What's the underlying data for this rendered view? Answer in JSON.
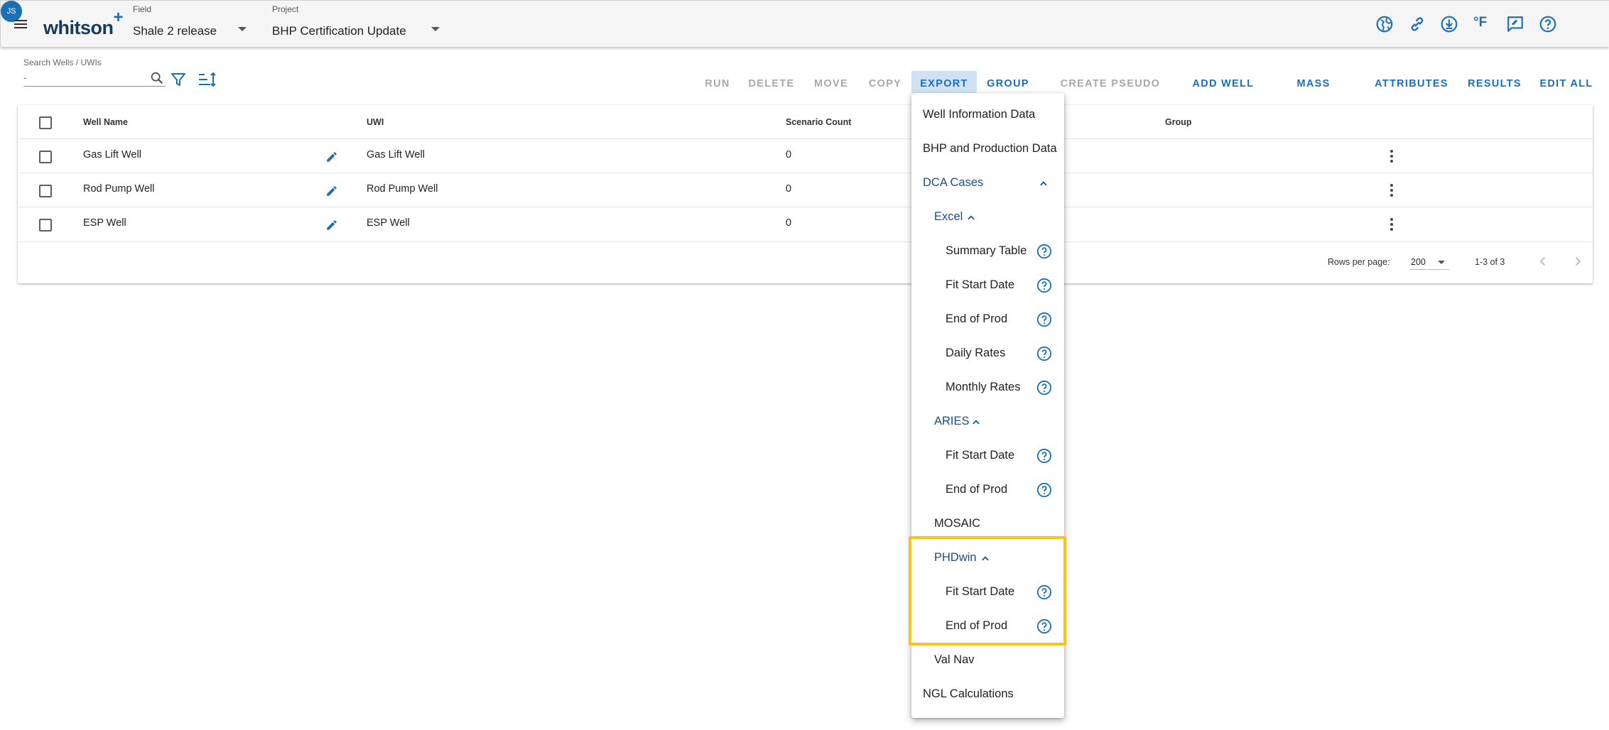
{
  "header": {
    "logo_text": "whitson",
    "logo_plus": "+",
    "field": {
      "label": "Field",
      "value": "Shale 2 release"
    },
    "project": {
      "label": "Project",
      "value": "BHP Certification Update"
    },
    "icons": [
      "globe-icon",
      "link-icon",
      "download-icon",
      "fahrenheit-icon",
      "feedback-icon",
      "help-icon"
    ],
    "fahrenheit_label": "°F",
    "avatar_initials": "JS"
  },
  "toolbar": {
    "search_label": "Search Wells / UWIs",
    "search_placeholder": "-",
    "buttons": {
      "run": "RUN",
      "delete": "DELETE",
      "move": "MOVE",
      "copy": "COPY",
      "export": "EXPORT",
      "group": "GROUP",
      "create_pseudo_well": "CREATE PSEUDO WELL",
      "add_well": "ADD WELL",
      "mass_upload": "MASS UPLOAD",
      "attributes": "ATTRIBUTES",
      "results": "RESULTS",
      "edit_all": "EDIT ALL"
    }
  },
  "table": {
    "columns": [
      "Well Name",
      "UWI",
      "Scenario Count",
      "Group"
    ],
    "rows": [
      {
        "well_name": "Gas Lift Well",
        "uwi": "Gas Lift Well",
        "scenario_count": "0",
        "group": ""
      },
      {
        "well_name": "Rod Pump Well",
        "uwi": "Rod Pump Well",
        "scenario_count": "0",
        "group": ""
      },
      {
        "well_name": "ESP Well",
        "uwi": "ESP Well",
        "scenario_count": "0",
        "group": ""
      }
    ],
    "footer": {
      "rows_per_page_label": "Rows per page:",
      "rows_per_page_value": "200",
      "range": "1-3 of 3"
    }
  },
  "export_menu": {
    "well_information": "Well Information Data",
    "bhp_production": "BHP and Production Data",
    "dca_cases": "DCA Cases",
    "excel": {
      "label": "Excel",
      "items": [
        "Summary Table",
        "Fit Start Date",
        "End of Prod",
        "Daily Rates",
        "Monthly Rates"
      ]
    },
    "aries": {
      "label": "ARIES",
      "items": [
        "Fit Start Date",
        "End of Prod"
      ]
    },
    "mosaic": "MOSAIC",
    "phdwin": {
      "label": "PHDwin",
      "items": [
        "Fit Start Date",
        "End of Prod"
      ]
    },
    "val_nav": "Val Nav",
    "ngl_calculations": "NGL Calculations"
  },
  "colors": {
    "accent": "#1a6fb5",
    "highlight": "#f5c518",
    "export_active_bg": "#cfe2f3"
  }
}
